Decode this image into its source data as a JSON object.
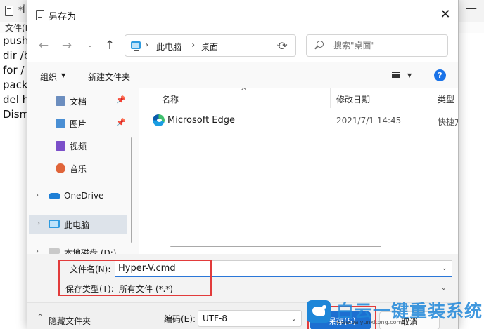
{
  "notepad": {
    "title": "*Ī",
    "menu_file": "文件(F)",
    "lines": [
      "push",
      "dir /b",
      "for /",
      "pack",
      "del h",
      "Dism"
    ],
    "minimize": "—"
  },
  "dialog": {
    "title": "另存为",
    "close": "✕",
    "nav": {
      "back": "←",
      "forward": "→",
      "recent": "⌄",
      "up": "↑",
      "breadcrumb": [
        "此电脑",
        "桌面"
      ],
      "separator": "›",
      "dropdown": "⌄",
      "refresh": "⟳",
      "search_placeholder": "搜索\"桌面\""
    },
    "toolbar": {
      "organize": "组织",
      "organize_caret": "▼",
      "new_folder": "新建文件夹",
      "view_caret": "▼",
      "help": "?"
    },
    "sidebar": {
      "items": [
        {
          "label": "文档",
          "icon": "documents-icon",
          "pinned": true
        },
        {
          "label": "图片",
          "icon": "pictures-icon",
          "pinned": true
        },
        {
          "label": "视频",
          "icon": "videos-icon",
          "pinned": false
        },
        {
          "label": "音乐",
          "icon": "music-icon",
          "pinned": false
        },
        {
          "label": "OneDrive",
          "icon": "onedrive-icon",
          "expandable": true
        },
        {
          "label": "此电脑",
          "icon": "this-pc-icon",
          "expandable": true,
          "selected": true
        },
        {
          "label": "本地磁盘 (D:)",
          "icon": "drive-icon",
          "expandable": true
        }
      ],
      "pin_glyph": "📌",
      "expand_glyph": "›"
    },
    "columns": {
      "name": "名称",
      "date": "修改日期",
      "type": "类型",
      "sort_arrow": "^"
    },
    "files": [
      {
        "name": "Microsoft Edge",
        "date": "2021/7/1 14:45",
        "type": "快捷方"
      }
    ],
    "form": {
      "filename_label": "文件名(N):",
      "filename_value": "Hyper-V.cmd",
      "filetype_label": "保存类型(T):",
      "filetype_value": "所有文件 (*.*)",
      "caret": "⌄"
    },
    "footer": {
      "hide_folders": "隐藏文件夹",
      "hide_caret": "^",
      "encoding_label": "编码(E):",
      "encoding_value": "UTF-8",
      "save": "保存(S)",
      "cancel": "取消"
    }
  },
  "watermark": {
    "title": "白云一键重装系统",
    "url": "www.baiyunxitong.com"
  },
  "colors": {
    "accent": "#1d6fd1",
    "highlight_red": "#e23b3b",
    "sidebar_selected": "#dde3ea",
    "watermark_blue": "#1e86d8"
  }
}
